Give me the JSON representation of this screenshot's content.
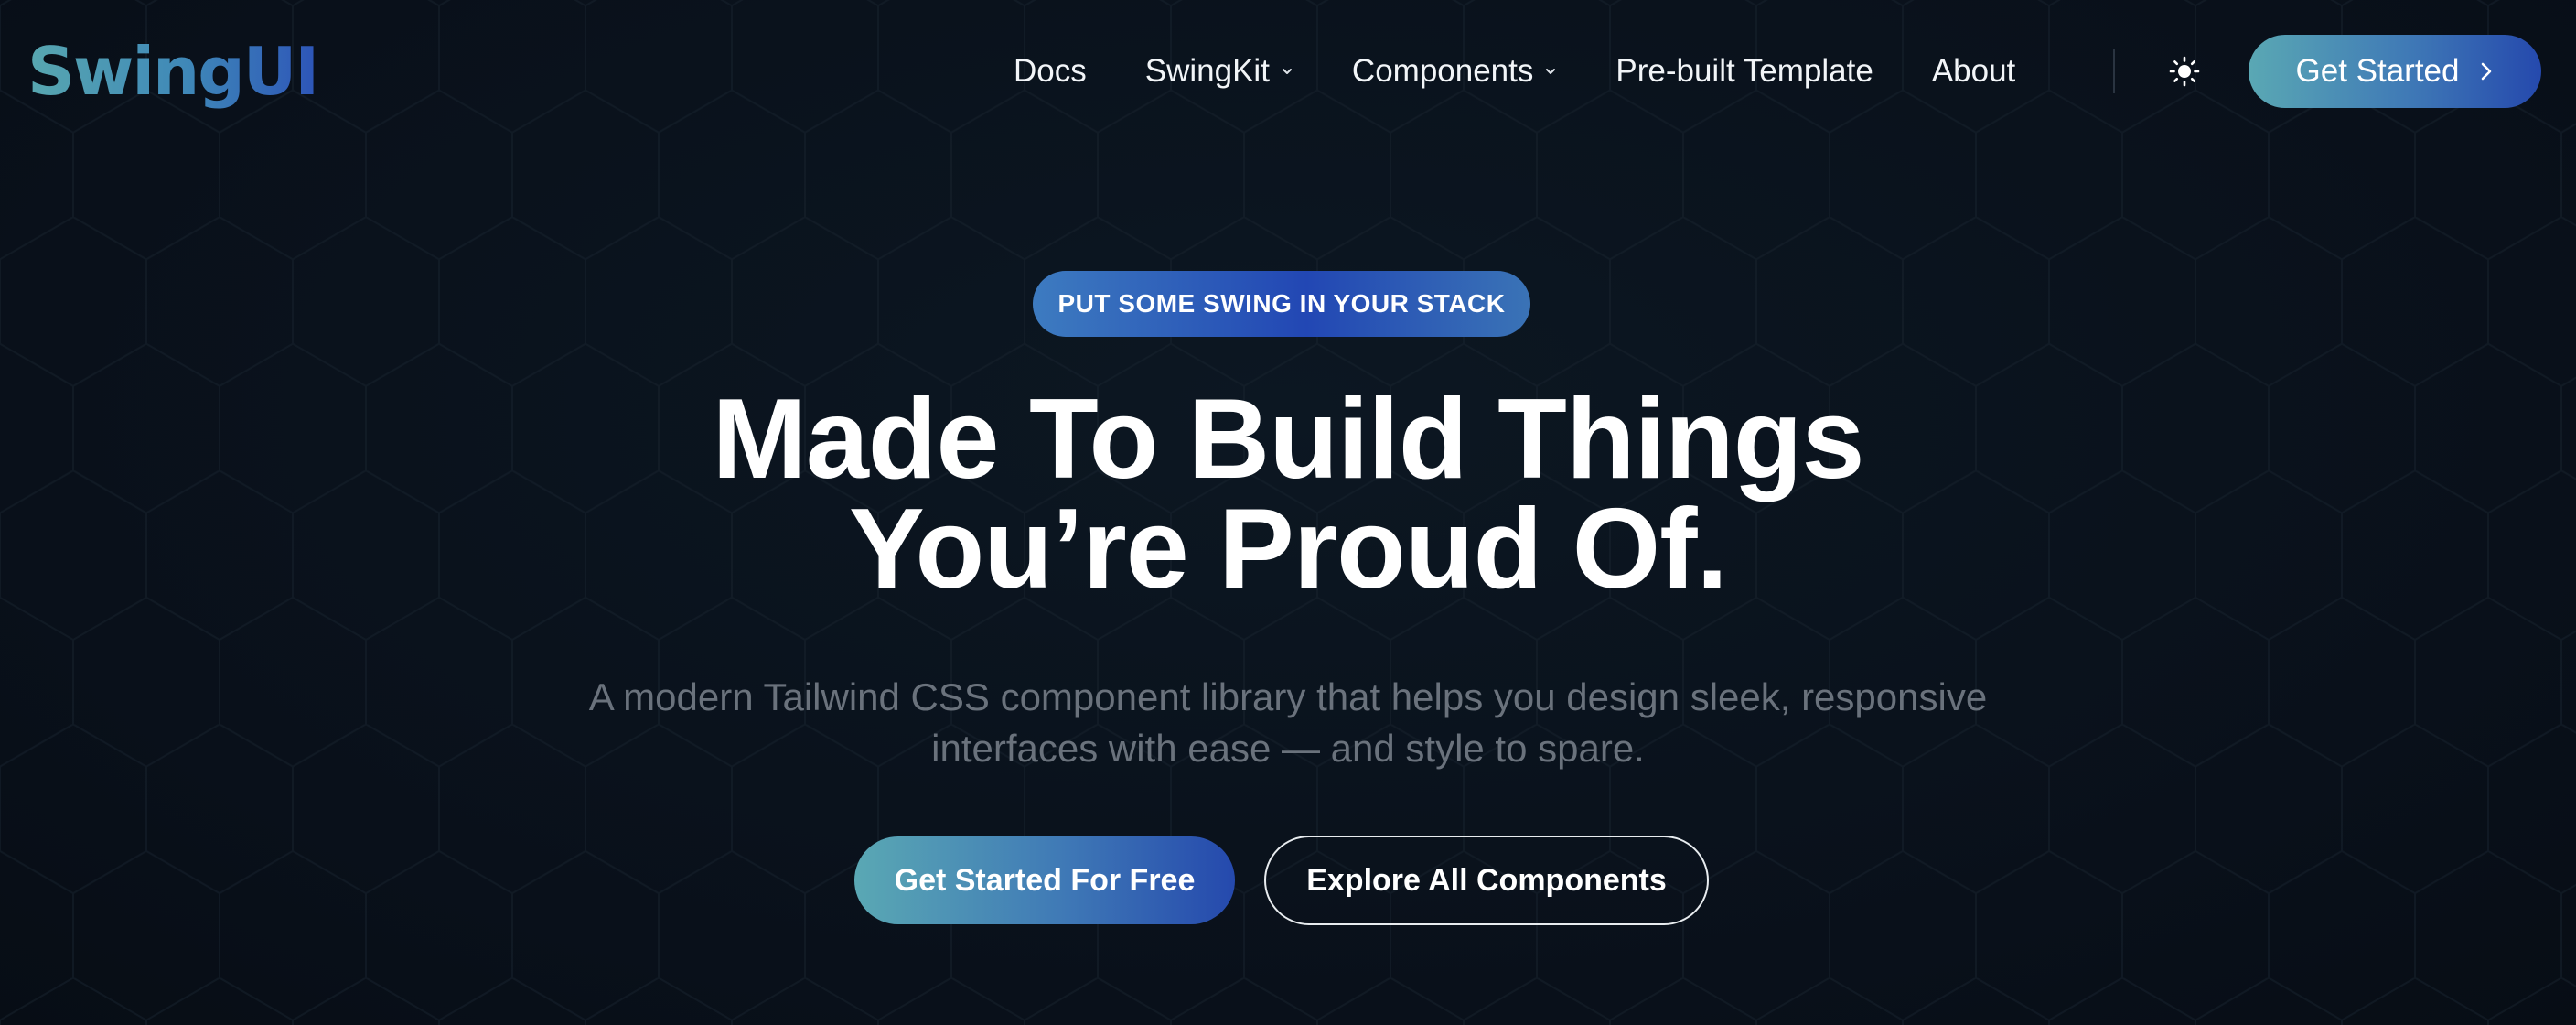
{
  "brand": {
    "logo_text": "SwingUI",
    "accent_start": "#5aa8b4",
    "accent_end": "#2549ad"
  },
  "nav": {
    "items": [
      {
        "label": "Docs",
        "has_dropdown": false
      },
      {
        "label": "SwingKit",
        "has_dropdown": true
      },
      {
        "label": "Components",
        "has_dropdown": true
      },
      {
        "label": "Pre-built Template",
        "has_dropdown": false
      },
      {
        "label": "About",
        "has_dropdown": false
      }
    ],
    "theme_icon": "sun-icon",
    "cta_label": "Get Started",
    "cta_icon": "chevron-right-icon"
  },
  "hero": {
    "badge": "PUT SOME SWING IN YOUR STACK",
    "headline_line1": "Made To Build Things",
    "headline_line2": "You’re Proud Of.",
    "sub_line1": "A modern Tailwind CSS component library that helps you design sleek, responsive",
    "sub_line2": "interfaces with ease — and style to spare.",
    "primary_button": "Get Started For Free",
    "secondary_button": "Explore All Components"
  },
  "colors": {
    "background": "#0a111b",
    "subtext": "#6a727c",
    "badge_start": "#3d7bc0",
    "badge_mid": "#2247b4"
  }
}
